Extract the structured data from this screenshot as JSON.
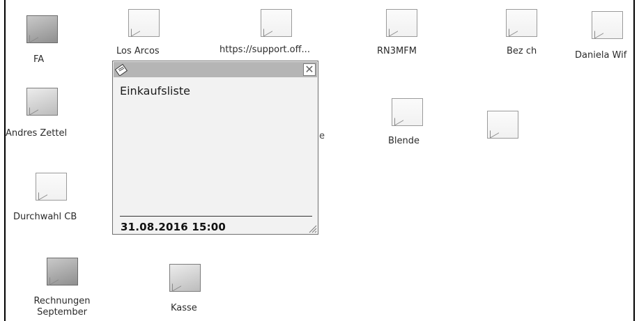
{
  "desktop": {
    "icons": [
      {
        "label": "FA"
      },
      {
        "label": "Los Arcos"
      },
      {
        "label": "https://support.off..."
      },
      {
        "label": "RN3MFM"
      },
      {
        "label": "Bez ch"
      },
      {
        "label": "Daniela Wif"
      },
      {
        "label": "Andres Zettel"
      },
      {
        "label": "Blende"
      },
      {
        "label": ""
      },
      {
        "label": "Durchwahl CB"
      },
      {
        "label": "Rechnungen September"
      },
      {
        "label": "Kasse"
      }
    ],
    "stray_text": "e"
  },
  "sticky_note": {
    "content": "Einkaufsliste",
    "timestamp": "31.08.2016 15:00",
    "close_glyph": "✕"
  }
}
